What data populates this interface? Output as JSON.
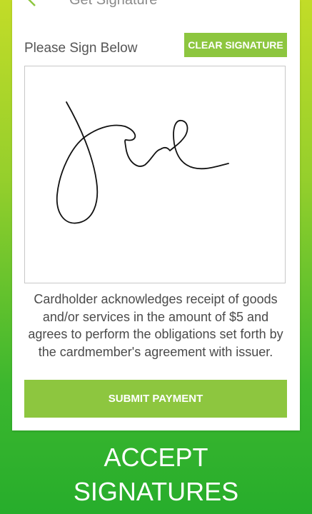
{
  "header": {
    "title": "Get Signature",
    "back_icon": "back-arrow-icon"
  },
  "signature": {
    "label": "Please Sign Below",
    "clear_label": "CLEAR SIGNATURE"
  },
  "acknowledgement": "Cardholder acknowledges receipt of goods and/or services in the amount of $5 and agrees to perform the obligations set forth by the cardmember's agreement with issuer.",
  "submit_label": "SUBMIT PAYMENT",
  "promo": {
    "line1": "ACCEPT",
    "line2": "SIGNATURES"
  },
  "colors": {
    "accent_green": "#8dc63f",
    "background_top": "#c2dc28",
    "background_bottom": "#27ad2c"
  }
}
